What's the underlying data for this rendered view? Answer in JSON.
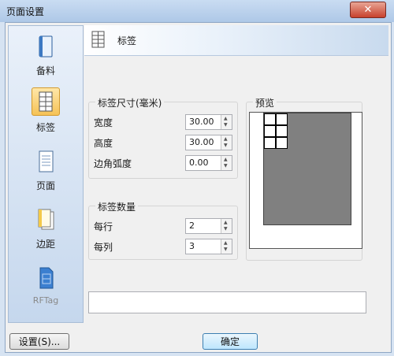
{
  "window": {
    "title": "页面设置",
    "close_glyph": "✕"
  },
  "sidebar": {
    "items": [
      {
        "label": "备料",
        "icon": "book-icon",
        "active": false
      },
      {
        "label": "标签",
        "icon": "label-grid-icon",
        "active": true
      },
      {
        "label": "页面",
        "icon": "page-icon",
        "active": false
      },
      {
        "label": "边距",
        "icon": "margin-icon",
        "active": false
      },
      {
        "label": "RFTag",
        "icon": "rftag-icon",
        "active": false,
        "disabled": true
      }
    ]
  },
  "header": {
    "title": "标签",
    "icon": "label-grid-icon"
  },
  "label_size": {
    "legend": "标签尺寸(毫米)",
    "width": {
      "label": "宽度",
      "value": "30.00"
    },
    "height": {
      "label": "高度",
      "value": "30.00"
    },
    "corner_radius": {
      "label": "边角弧度",
      "value": "0.00"
    }
  },
  "label_count": {
    "legend": "标签数量",
    "per_row": {
      "label": "每行",
      "value": "2"
    },
    "per_column": {
      "label": "每列",
      "value": "3"
    }
  },
  "preview": {
    "legend": "预览"
  },
  "status": {
    "text": ""
  },
  "buttons": {
    "settings": "设置(S)...",
    "ok": "确定"
  },
  "colors": {
    "accent": "#3c7fb1",
    "close": "#c7412d",
    "active_nav": "#f5c256"
  }
}
